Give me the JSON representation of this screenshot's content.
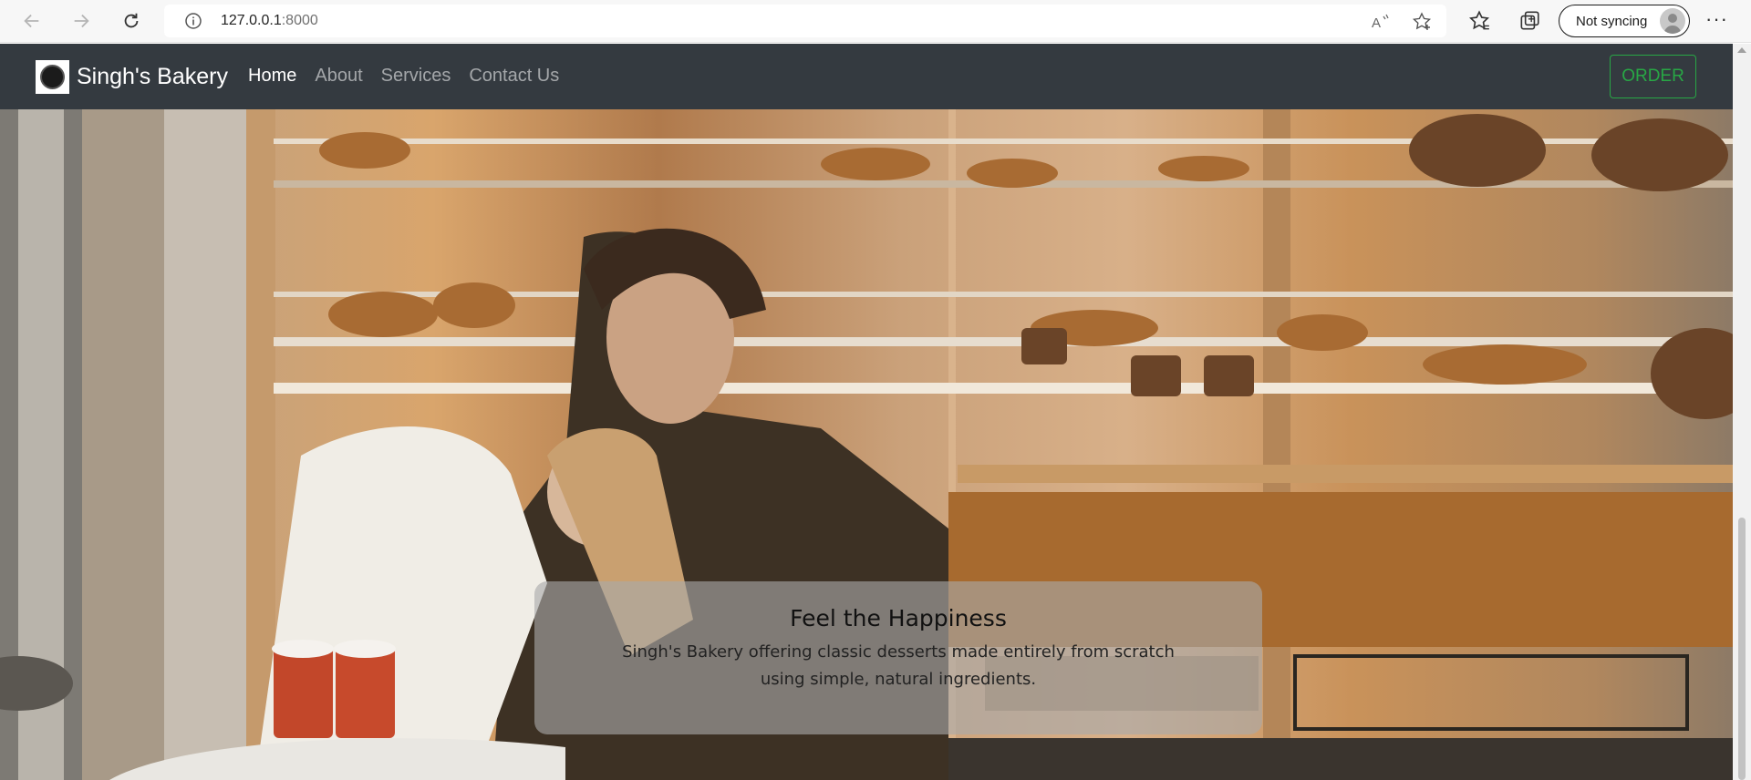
{
  "browser": {
    "url_host": "127.0.0.1",
    "url_port": ":8000",
    "sync_label": "Not syncing",
    "more_label": "···"
  },
  "navbar": {
    "brand": "Singh's Bakery",
    "items": [
      {
        "label": "Home",
        "active": true
      },
      {
        "label": "About",
        "active": false
      },
      {
        "label": "Services",
        "active": false
      },
      {
        "label": "Contact Us",
        "active": false
      }
    ],
    "order_label": "ORDER"
  },
  "hero": {
    "caption_title": "Feel the Happiness",
    "caption_text": "Singh's Bakery offering classic desserts made entirely from scratch using simple, natural ingredients."
  },
  "colors": {
    "navbar_bg": "#343a40",
    "order_accent": "#28a745"
  }
}
